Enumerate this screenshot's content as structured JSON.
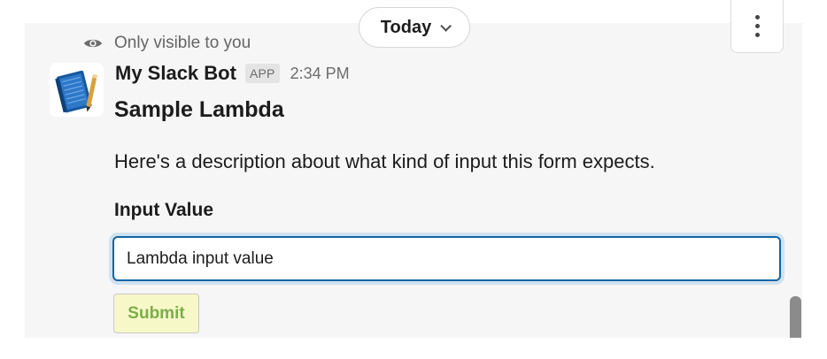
{
  "date_divider": {
    "label": "Today",
    "icon": "chevron-down-icon"
  },
  "message_actions": {
    "icon": "more-vertical-icon"
  },
  "message": {
    "visibility_text": "Only visible to you",
    "visibility_icon": "eye-icon",
    "bot": {
      "name": "My Slack Bot",
      "badge": "APP",
      "timestamp": "2:34 PM",
      "avatar_icon": "blue-notebook-icon"
    },
    "form": {
      "title": "Sample Lambda",
      "description": "Here's a description about what kind of input this form expects.",
      "input_label": "Input Value",
      "input_value": "Lambda input value",
      "submit_label": "Submit"
    }
  },
  "colors": {
    "focus_border": "#1264a3",
    "submit_background": "#f7f8c8",
    "submit_text": "#7cad4a",
    "message_background": "#f6f6f6"
  }
}
